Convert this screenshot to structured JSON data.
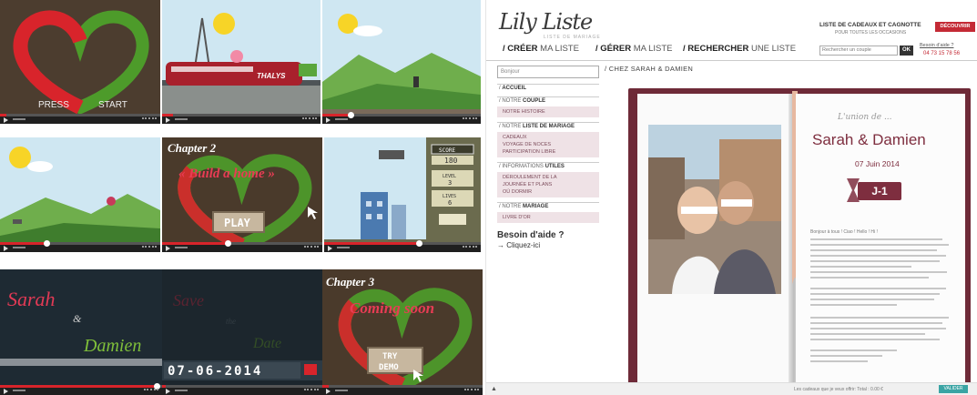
{
  "collage": {
    "press_start": "PRESS START",
    "press": "PRESS",
    "start": "START",
    "train_label": "THALYS",
    "chapter2": "Chapter 2",
    "build_home": "« Build a home »",
    "play": "PLAY",
    "score_label": "SCORE",
    "score_value": "180",
    "level_label": "LEVEL",
    "level_value": "3",
    "lives_label": "LIVES",
    "lives_value": "6",
    "sarah": "Sarah",
    "amp": "&",
    "damien": "Damien",
    "save": "Save",
    "the": "the",
    "date_word": "Date",
    "counter": "07-06-2014",
    "chapter3": "Chapter 3",
    "coming_soon": "Coming soon",
    "try_demo_1": "TRY",
    "try_demo_2": "DEMO",
    "colors": {
      "heart_red": "#d8242b",
      "heart_green": "#4ea52a",
      "progress": "#d8242b",
      "sky": "#cfe7f2",
      "grass": "#5aa63c",
      "dark": "#1e2a33"
    }
  },
  "site": {
    "logo": "Lily Liste",
    "logo_sub": "LISTE DE MARIAGE",
    "nav": [
      {
        "bold": "/ CRÉER",
        "rest": " MA LISTE"
      },
      {
        "bold": "/ GÉRER",
        "rest": " MA LISTE"
      },
      {
        "bold": "/ RECHERCHER",
        "rest": " UNE LISTE"
      }
    ],
    "gift_title": "LISTE DE CADEAUX ET CAGNOTTE",
    "gift_sub": "POUR TOUTES LES OCCASIONS",
    "discover": "DÉCOUVRIR",
    "search_placeholder": "Rechercher un couple",
    "ok": "OK",
    "help_link": "Besoin d'aide ?",
    "phone": "04 73 15 78 56",
    "side_search": "Bonjour",
    "sections": [
      {
        "pre": "/ ",
        "bold": "ACCUEIL",
        "post": ""
      },
      {
        "pre": "/ NOTRE ",
        "bold": "COUPLE",
        "post": ""
      }
    ],
    "couple_items": [
      "NOTRE HISTOIRE"
    ],
    "liste_section": {
      "pre": "/ NOTRE ",
      "bold": "LISTE DE MARIAGE",
      "post": ""
    },
    "liste_items": [
      "CADEAUX",
      "VOYAGE DE NOCES",
      "PARTICIPATION LIBRE"
    ],
    "info_section": {
      "pre": "/ INFORMATIONS ",
      "bold": "UTILES",
      "post": ""
    },
    "info_items": [
      "DÉROULEMENT DE LA",
      "JOURNÉE ET PLANS",
      "OÙ DORMIR"
    ],
    "mariage_section": {
      "pre": "/ NOTRE ",
      "bold": "MARIAGE",
      "post": ""
    },
    "mariage_items": [
      "LIVRE D'OR"
    ],
    "help_title": "Besoin d'aide ?",
    "help_cta": "→ Cliquez-ici",
    "breadcrumb": "/ CHEZ SARAH        & DAMIEN",
    "invite": "L'union de ...",
    "couple": "Sarah & Damien",
    "date": "07 Juin 2014",
    "countdown": "J-1",
    "greeting": "Bonjour à tous ! Ciao ! Hello ! Hi !",
    "footer_text": "Les cadeaux que je veux offrir: Total : 0.00 €",
    "footer_button": "VALIDER",
    "colors": {
      "accent": "#7e2e3f",
      "book": "#6e2a38",
      "menu_bg": "#efe2e6",
      "discover": "#c42a35",
      "validate": "#3aa4a4"
    }
  }
}
